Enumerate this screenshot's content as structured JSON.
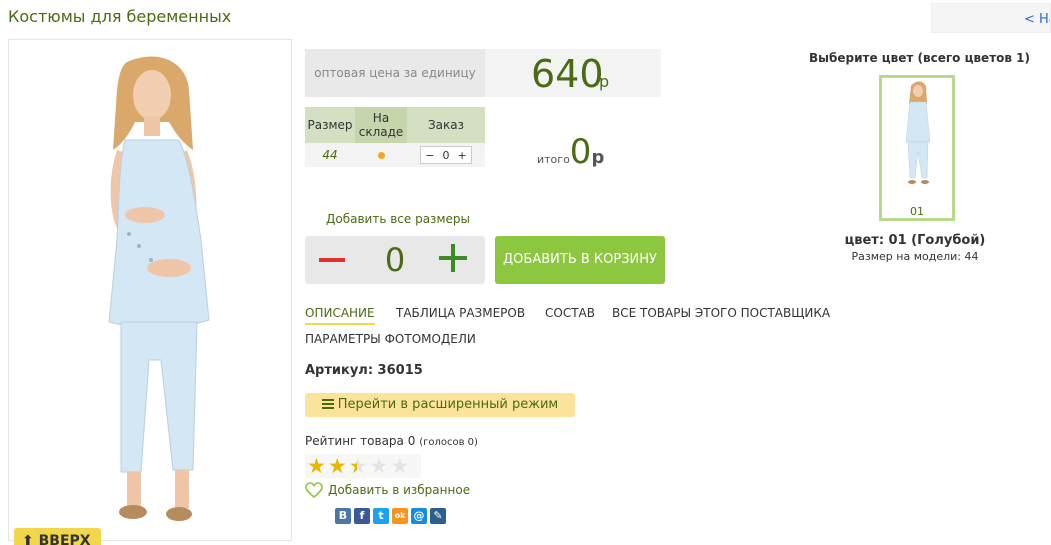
{
  "header": {
    "title": "Костюмы для беременных",
    "back_label": "< На"
  },
  "product": {
    "scroll_up_label": "ВВЕРХ",
    "price_label": "оптовая цена за единицу",
    "price_value": "640",
    "price_currency": "р",
    "sizes_table": {
      "headers": [
        "Размер",
        "На складе",
        "Заказ"
      ],
      "rows": [
        {
          "size": "44",
          "in_stock": true,
          "order_qty": "0"
        }
      ]
    },
    "total_label": "итого",
    "total_value": "0",
    "total_currency": "р",
    "add_all_sizes_label": "Добавить все размеры",
    "quantity": "0",
    "add_to_cart_label": "ДОБАВИТЬ В КОРЗИНУ",
    "tabs": [
      "ОПИСАНИЕ",
      "ТАБЛИЦА РАЗМЕРОВ",
      "СОСТАВ",
      "ВСЕ ТОВАРЫ ЭТОГО ПОСТАВЩИКА",
      "ПАРАМЕТРЫ ФОТОМОДЕЛИ"
    ],
    "active_tab": "ОПИСАНИЕ",
    "sku_text": "Артикул: 36015",
    "advanced_mode_label": "Перейти в расширенный режим",
    "rating_label": "Рейтинг товара 0",
    "rating_votes": "(голосов 0)",
    "rating_stars": 2.5,
    "rating_max": 5,
    "favorite_label": "Добавить в избранное",
    "social": [
      {
        "name": "vkontakte-icon",
        "glyph": "В",
        "color": "#4a76a8"
      },
      {
        "name": "facebook-icon",
        "glyph": "f",
        "color": "#3b5998"
      },
      {
        "name": "twitter-icon",
        "glyph": "t",
        "color": "#1da1f2"
      },
      {
        "name": "odnoklassniki-icon",
        "glyph": "ok",
        "color": "#f7931e"
      },
      {
        "name": "mailru-icon",
        "glyph": "@",
        "color": "#168de2"
      },
      {
        "name": "livejournal-icon",
        "glyph": "✎",
        "color": "#2c5f8a"
      }
    ]
  },
  "colors": {
    "heading": "Выберите цвет (всего цветов 1)",
    "items": [
      {
        "code": "01"
      }
    ],
    "selected_label": "цвет: 01 (Голубой)",
    "model_size_label": "Размер на модели: 44"
  },
  "accent_colors": {
    "green_text": "#4a6b12",
    "cart_button": "#8dc63f",
    "advanced_button": "#fbe39b",
    "star": "#e6b800"
  }
}
